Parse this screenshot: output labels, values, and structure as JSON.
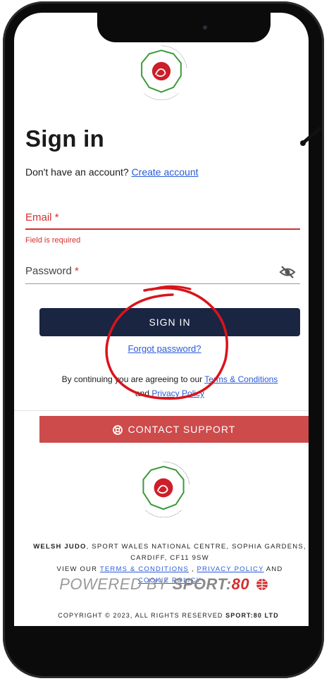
{
  "header": {
    "title": "Sign in",
    "signup_prompt": "Don't have an account?",
    "create_account": "Create account"
  },
  "logo": {
    "top_text": "Cymdeithas Judo Cymru",
    "bottom_text": "Welsh Judo Association"
  },
  "form": {
    "email_label": "Email",
    "required_mark": "*",
    "email_error": "Field is required",
    "password_label": "Password"
  },
  "actions": {
    "signin_label": "SIGN IN",
    "forgot_label": "Forgot password?"
  },
  "terms": {
    "prefix": "By continuing you are agreeing to our",
    "terms_link": "Terms & Conditions",
    "and_text": "and",
    "privacy_link": "Privacy Policy"
  },
  "support": {
    "label": "CONTACT SUPPORT",
    "icon": "lifebuoy-icon"
  },
  "footer": {
    "org_name": "WELSH JUDO",
    "address": ", SPORT WALES NATIONAL CENTRE, SOPHIA GARDENS, CARDIFF, CF11 9SW",
    "view_our": "VIEW OUR",
    "terms_link": "TERMS & CONDITIONS",
    "comma": ",",
    "privacy_link": "PRIVACY POLICY",
    "and_text": "AND",
    "cookie_link": "COOKIE POLICY",
    "powered_prefix": "POWERED BY",
    "powered_brand": "SPORT:",
    "powered_num": "80",
    "copyright_prefix": "COPYRIGHT © 2023, ALL RIGHTS RESERVED",
    "copyright_brand": "SPORT:80 LTD"
  },
  "colors": {
    "primary": "#1a2542",
    "error": "#d32f2f",
    "support": "#cd4b4b",
    "link": "#2a5bd7",
    "annotation": "#d9141b"
  }
}
